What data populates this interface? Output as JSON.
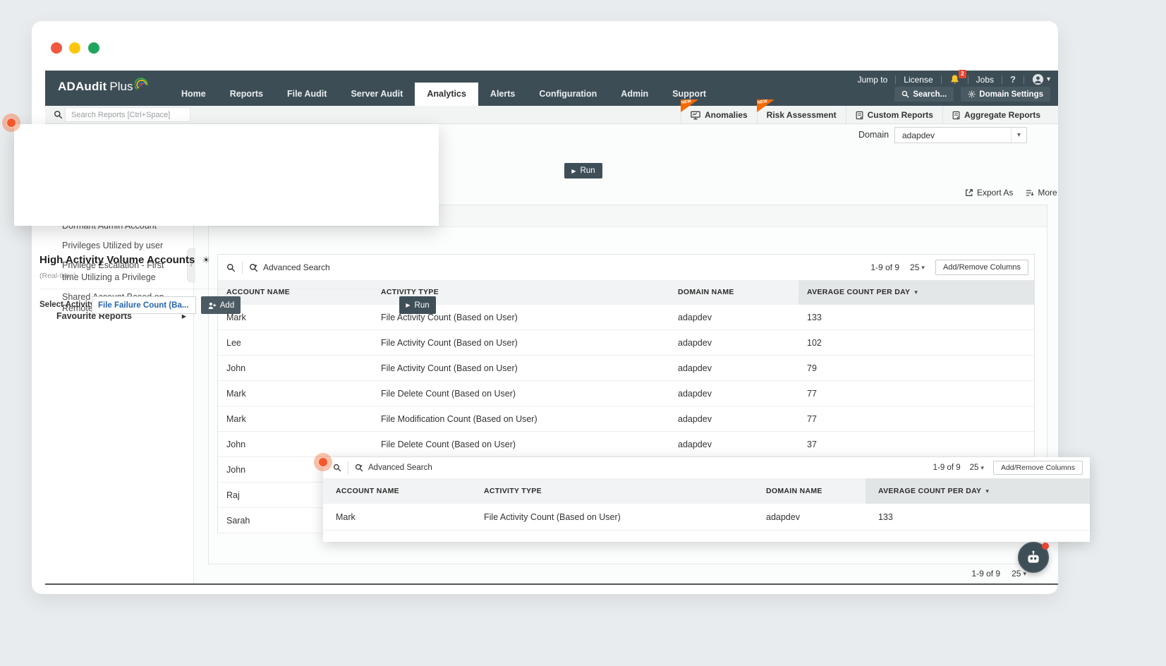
{
  "window": {
    "traffic_light_colors": [
      "#f2573f",
      "#fdc60b",
      "#21a45d"
    ]
  },
  "header": {
    "logo_primary": "ADAudit",
    "logo_secondary": "Plus",
    "nav": [
      "Home",
      "Reports",
      "File Audit",
      "Server Audit",
      "Analytics",
      "Alerts",
      "Configuration",
      "Admin",
      "Support"
    ],
    "links": {
      "jump_to": "Jump to",
      "license": "License",
      "jobs": "Jobs",
      "help": "?"
    },
    "notification_count": "2",
    "search_button": "Search...",
    "domain_settings_button": "Domain Settings"
  },
  "toolbar": {
    "search_placeholder": "Search Reports [Ctrl+Space]",
    "new_badge": "NEW",
    "tabs": [
      {
        "label": "Anomalies",
        "new": true
      },
      {
        "label": "Risk Assessment",
        "new": true
      },
      {
        "label": "Custom Reports",
        "new": false
      },
      {
        "label": "Aggregate Reports",
        "new": false
      }
    ]
  },
  "activity_popup": {
    "title": "High Activity Volume Accounts",
    "subtitle": "(Real-time)",
    "select_activity_label": "Select Activity",
    "activity_value": "File Failure Count (Ba...",
    "add_button": "Add",
    "run_button": "Run"
  },
  "report_header": {
    "domain_label": "Domain",
    "domain_value": "adapdev",
    "run_button": "Run",
    "export_as": "Export As",
    "more": "More"
  },
  "sidebar": {
    "items": [
      "Dormant Admin Account",
      "Privileges Utilized by user",
      "Privilege Escalation - First time Utilizing a Privilege",
      "Shared Account Based on Remote Logon"
    ],
    "favourite_reports": "Favourite Reports"
  },
  "main_table": {
    "advanced_search": "Advanced Search",
    "range": "1-9 of 9",
    "page_size": "25",
    "add_remove_columns": "Add/Remove Columns",
    "columns": [
      "ACCOUNT NAME",
      "ACTIVITY TYPE",
      "DOMAIN NAME",
      "AVERAGE COUNT PER DAY"
    ],
    "rows": [
      {
        "account_name": "Mark",
        "activity_type": "File Activity Count (Based on User)",
        "domain_name": "adapdev",
        "avg_count": "133"
      },
      {
        "account_name": "Lee",
        "activity_type": "File Activity Count (Based on User)",
        "domain_name": "adapdev",
        "avg_count": "102"
      },
      {
        "account_name": "John",
        "activity_type": "File Activity Count (Based on User)",
        "domain_name": "adapdev",
        "avg_count": "79"
      },
      {
        "account_name": "Mark",
        "activity_type": "File Delete Count (Based on User)",
        "domain_name": "adapdev",
        "avg_count": "77"
      },
      {
        "account_name": "Mark",
        "activity_type": "File Modification Count (Based on User)",
        "domain_name": "adapdev",
        "avg_count": "77"
      },
      {
        "account_name": "John",
        "activity_type": "File Delete Count (Based on User)",
        "domain_name": "adapdev",
        "avg_count": "37"
      },
      {
        "account_name": "John",
        "activity_type": "",
        "domain_name": "",
        "avg_count": ""
      },
      {
        "account_name": "Raj",
        "activity_type": "",
        "domain_name": "",
        "avg_count": ""
      },
      {
        "account_name": "Sarah",
        "activity_type": "",
        "domain_name": "",
        "avg_count": ""
      }
    ],
    "footer_range": "1-9 of 9",
    "footer_page_size": "25"
  },
  "overlay_table": {
    "advanced_search": "Advanced Search",
    "range": "1-9 of 9",
    "page_size": "25",
    "add_remove_columns": "Add/Remove Columns",
    "columns": [
      "ACCOUNT NAME",
      "ACTIVITY TYPE",
      "DOMAIN NAME",
      "AVERAGE COUNT PER DAY"
    ],
    "rows": [
      {
        "account_name": "Mark",
        "activity_type": "File Activity Count (Based on User)",
        "domain_name": "adapdev",
        "avg_count": "133"
      }
    ]
  },
  "icons": {
    "chevron_down": "▾",
    "arrow_right": "▸",
    "play": "▶",
    "sun": "☀",
    "collapse": "‹"
  }
}
